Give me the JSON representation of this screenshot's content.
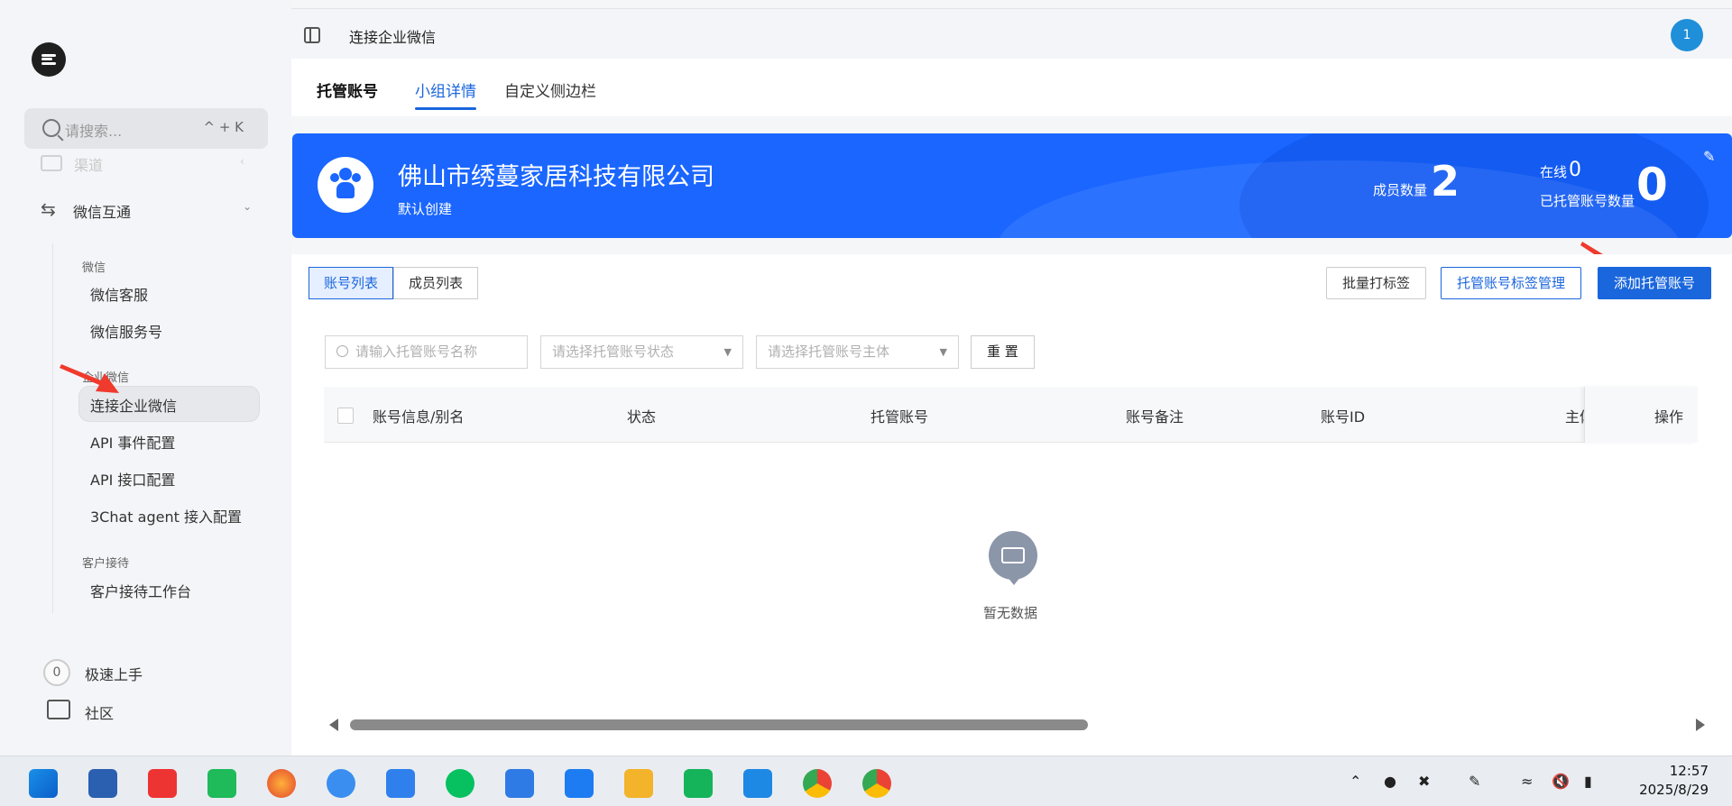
{
  "sidebar": {
    "search_placeholder": "请搜索...",
    "search_shortcut": "^ + K",
    "faded_item": "渠道",
    "group_label": "微信互通",
    "sections": [
      {
        "title": "微信",
        "items": [
          "微信客服",
          "微信服务号"
        ]
      },
      {
        "title": "企业微信",
        "items": [
          "连接企业微信",
          "API 事件配置",
          "API 接口配置",
          "3Chat agent 接入配置"
        ]
      },
      {
        "title": "客户接待",
        "items": [
          "客户接待工作台"
        ]
      }
    ],
    "quick_badge": "0",
    "quick_label": "极速上手",
    "community_label": "社区"
  },
  "header": {
    "title": "连接企业微信",
    "avatar_text": "1"
  },
  "tabs": [
    "托管账号",
    "小组详情",
    "自定义侧边栏"
  ],
  "banner": {
    "company": "佛山市绣蔓家居科技有限公司",
    "subtitle": "默认创建",
    "member_label": "成员数量",
    "member_count": "2",
    "online_label": "在线",
    "online_count": "0",
    "hosted_label": "已托管账号数量",
    "hosted_count": "0"
  },
  "toolbar": {
    "seg_accounts": "账号列表",
    "seg_members": "成员列表",
    "batch_tag": "批量打标签",
    "tag_manage": "托管账号标签管理",
    "add_account": "添加托管账号"
  },
  "filters": {
    "name_placeholder": "请输入托管账号名称",
    "status_placeholder": "请选择托管账号状态",
    "subject_placeholder": "请选择托管账号主体",
    "reset": "重 置"
  },
  "table": {
    "columns": [
      "账号信息/别名",
      "状态",
      "托管账号",
      "账号备注",
      "账号ID",
      "主体",
      "操作"
    ],
    "empty_text": "暂无数据"
  },
  "taskbar": {
    "time": "12:57",
    "date": "2025/8/29"
  },
  "colors": {
    "primary": "#1a66dd",
    "banner": "#1a66ff",
    "avatar": "#1f8fd9"
  }
}
